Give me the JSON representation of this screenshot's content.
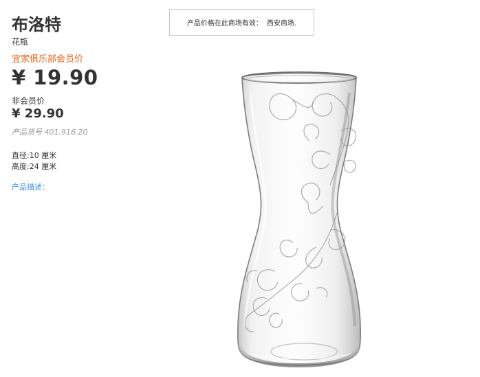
{
  "product": {
    "name": "布洛特",
    "type": "花瓶",
    "member_price_label": "宜家俱乐部会员价",
    "member_price": "¥ 19.90",
    "nonmember_label": "非会员价",
    "nonmember_price": "¥ 29.90",
    "article_number": "产品货号 401.916.20",
    "dimensions": [
      "直径:10 厘米",
      "高度:24 厘米"
    ],
    "description_link": "产品描述："
  },
  "store_notice": {
    "text": "产品价格在此商场有效：",
    "store": "西安商场."
  },
  "image": {
    "icon": "glass-vase-illustration"
  },
  "colors": {
    "accent_orange": "#e8641e",
    "link_blue": "#3b8ed8",
    "muted_gray": "#999999"
  }
}
